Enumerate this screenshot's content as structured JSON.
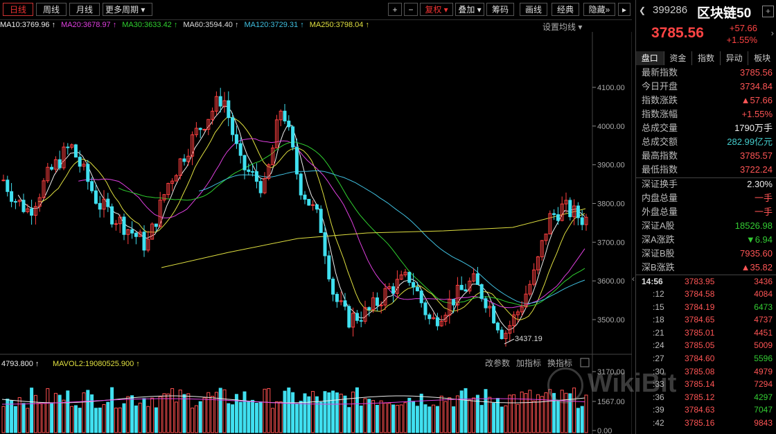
{
  "toolbar": {
    "periods": [
      "日线",
      "周线",
      "月线",
      "更多周期"
    ],
    "zoom_in": "+",
    "zoom_out": "−",
    "adjust": "复权",
    "overlay": "叠加",
    "chips": "筹码",
    "draw": "画线",
    "classic": "经典",
    "hide": "隐藏"
  },
  "ma_legend": [
    {
      "text": "MA10:3769.96",
      "color": "#eeeeee"
    },
    {
      "text": "MA20:3678.97",
      "color": "#e040e0"
    },
    {
      "text": "MA30:3633.42",
      "color": "#30d030"
    },
    {
      "text": "MA60:3594.40",
      "color": "#dddddd"
    },
    {
      "text": "MA120:3729.31",
      "color": "#40c0e0"
    },
    {
      "text": "MA250:3798.04",
      "color": "#e0e040"
    }
  ],
  "settings_label": "设置均线",
  "price_axis": [
    "4100.00",
    "4000.00",
    "3900.00",
    "3800.00",
    "3700.00",
    "3600.00",
    "3500.00"
  ],
  "low_label": "3437.19",
  "volume_legend": [
    {
      "text": "4793.800",
      "color": "#eeeeee"
    },
    {
      "text": "MAVOL2:19080525.900",
      "color": "#e0e040"
    }
  ],
  "volume_tools": [
    "改参数",
    "加指标",
    "换指标"
  ],
  "volume_axis": [
    "3170.00",
    "1567.00",
    "0.00"
  ],
  "stock": {
    "code": "399286",
    "name": "区块链50",
    "price": "3785.56",
    "change": "+57.66",
    "change_pct": "+1.55%"
  },
  "tabs": [
    "盘口",
    "资金",
    "指数",
    "异动",
    "板块"
  ],
  "quote_rows": [
    {
      "label": "最新指数",
      "value": "3785.56",
      "color": "red"
    },
    {
      "label": "今日开盘",
      "value": "3734.84",
      "color": "red"
    },
    {
      "label": "指数涨跌",
      "value": "▲57.66",
      "color": "red"
    },
    {
      "label": "指数涨幅",
      "value": "+1.55%",
      "color": "red"
    },
    {
      "label": "总成交量",
      "value": "1790万手",
      "color": "white"
    },
    {
      "label": "总成交额",
      "value": "282.99亿元",
      "color": "cyan"
    },
    {
      "label": "最高指数",
      "value": "3785.57",
      "color": "red"
    },
    {
      "label": "最低指数",
      "value": "3722.24",
      "color": "red"
    }
  ],
  "quote_rows2": [
    {
      "label": "深证换手",
      "value": "2.30%",
      "color": "white"
    },
    {
      "label": "内盘总量",
      "value": "一手",
      "color": "red"
    },
    {
      "label": "外盘总量",
      "value": "一手",
      "color": "red"
    },
    {
      "label": "深证A股",
      "value": "18526.98",
      "color": "green"
    },
    {
      "label": "深A涨跌",
      "value": "▼6.94",
      "color": "green"
    },
    {
      "label": "深证B股",
      "value": "7935.60",
      "color": "red"
    },
    {
      "label": "深B涨跌",
      "value": "▲35.82",
      "color": "red"
    }
  ],
  "ticks_header": {
    "time": "14:56",
    "price": "3783.95",
    "vol": "3436"
  },
  "ticks": [
    {
      "t": ":12",
      "p": "3784.58",
      "v": "4084",
      "c": "red"
    },
    {
      "t": ":15",
      "p": "3784.19",
      "v": "6473",
      "c": "green"
    },
    {
      "t": ":18",
      "p": "3784.65",
      "v": "4737",
      "c": "red"
    },
    {
      "t": ":21",
      "p": "3785.01",
      "v": "4451",
      "c": "red"
    },
    {
      "t": ":24",
      "p": "3785.05",
      "v": "5009",
      "c": "red"
    },
    {
      "t": ":27",
      "p": "3784.60",
      "v": "5596",
      "c": "green"
    },
    {
      "t": ":30",
      "p": "3785.08",
      "v": "4979",
      "c": "red"
    },
    {
      "t": ":33",
      "p": "3785.14",
      "v": "7294",
      "c": "red"
    },
    {
      "t": ":36",
      "p": "3785.12",
      "v": "4297",
      "c": "green"
    },
    {
      "t": ":39",
      "p": "3784.63",
      "v": "7047",
      "c": "green"
    },
    {
      "t": ":42",
      "p": "3785.16",
      "v": "9843",
      "c": "red"
    }
  ],
  "watermark": "WikiBit"
}
